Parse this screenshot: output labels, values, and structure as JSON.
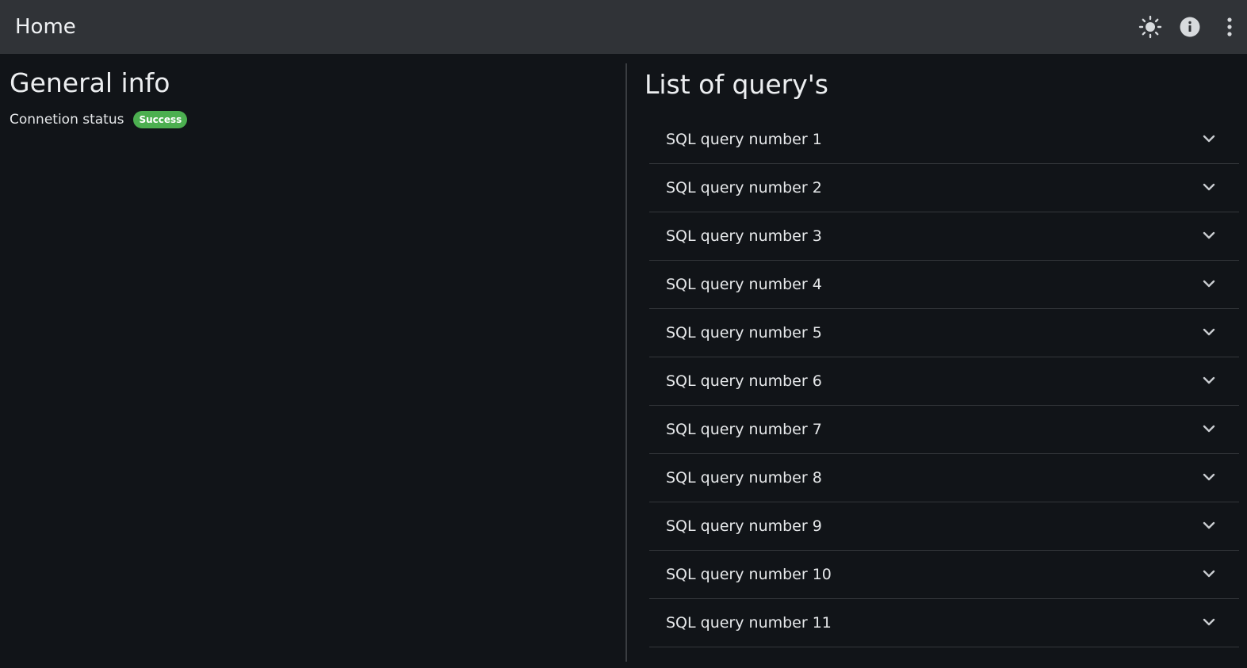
{
  "appbar": {
    "title": "Home",
    "actions": [
      {
        "icon": "sun-icon",
        "name": "theme-toggle-button"
      },
      {
        "icon": "info-icon",
        "name": "info-button"
      },
      {
        "icon": "more-vert-icon",
        "name": "more-menu-button"
      }
    ]
  },
  "general": {
    "title": "General info",
    "status_label": "Connetion status",
    "status_value": "Success",
    "status_color": "#4caf50"
  },
  "queries": {
    "title": "List of query's",
    "items": [
      {
        "label": "SQL query number 1"
      },
      {
        "label": "SQL query number 2"
      },
      {
        "label": "SQL query number 3"
      },
      {
        "label": "SQL query number 4"
      },
      {
        "label": "SQL query number 5"
      },
      {
        "label": "SQL query number 6"
      },
      {
        "label": "SQL query number 7"
      },
      {
        "label": "SQL query number 8"
      },
      {
        "label": "SQL query number 9"
      },
      {
        "label": "SQL query number 10"
      },
      {
        "label": "SQL query number 11"
      }
    ]
  },
  "colors": {
    "appbar_bg": "#303337",
    "page_bg": "#111418",
    "text": "#e6e8ea",
    "success": "#4caf50"
  }
}
